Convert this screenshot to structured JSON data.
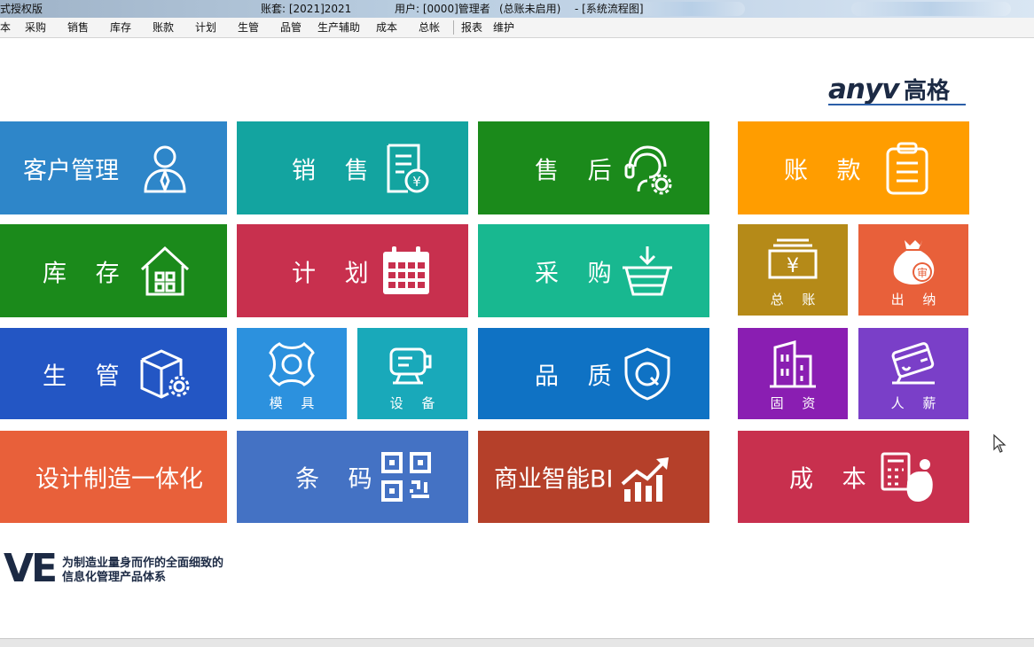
{
  "window": {
    "app_title": "式授权版",
    "account": "账套: [2021]2021",
    "user": "用户: [0000]管理者",
    "ledger_status": "(总账未启用)",
    "view": "- [系统流程图]"
  },
  "menu": {
    "items": [
      "本",
      "采购",
      "销售",
      "库存",
      "账款",
      "计划",
      "生管",
      "品管",
      "生产辅助",
      "成本",
      "总帐",
      "报表",
      "维护"
    ]
  },
  "logo": {
    "en": "anyv",
    "cn": "高格"
  },
  "tiles": {
    "customer": "客户管理",
    "sales": "销 售",
    "aftersales": "售 后",
    "accounts": "账 款",
    "inventory": "库 存",
    "plan": "计 划",
    "purchase": "采 购",
    "ledger": "总 账",
    "cashier": "出 纳",
    "production": "生 管",
    "mold": "模 具",
    "equipment": "设 备",
    "quality": "品 质",
    "fixed_assets": "固 资",
    "payroll": "人 薪",
    "cad": "设计制造一体化",
    "barcode": "条 码",
    "bi": "商业智能BI",
    "cost": "成 本"
  },
  "slogan": {
    "mark": "VE",
    "line1": "为制造业量身而作的全面细致的",
    "line2": "信息化管理产品体系"
  },
  "colors": {
    "blue": "#2e86c9",
    "teal": "#13a4a0",
    "green": "#1b8a1b",
    "orange": "#ff9d00",
    "crimson": "#c8304e",
    "mint": "#18b890",
    "gold": "#b58a18",
    "coral": "#e8603a",
    "royal": "#2356c4",
    "sky": "#2c91de",
    "cyan": "#19a9ba",
    "azure": "#0f72c4",
    "purple": "#8a1eb2",
    "violet": "#7a3fc8",
    "steel": "#4472c4",
    "rust": "#b5402a"
  }
}
